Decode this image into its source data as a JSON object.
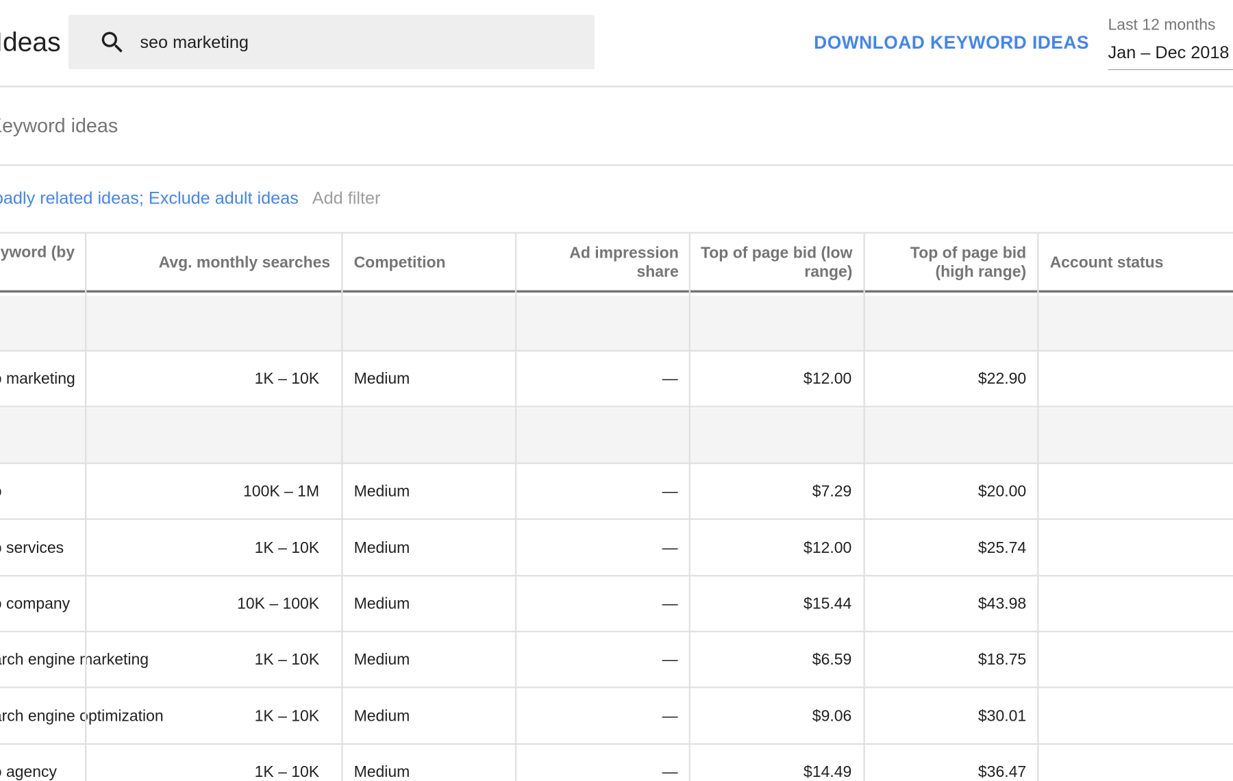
{
  "header": {
    "title": "Ideas",
    "search": {
      "value": "seo marketing"
    },
    "download_label": "DOWNLOAD KEYWORD IDEAS",
    "date_range": {
      "label": "Last 12 months",
      "value": "Jan – Dec 2018"
    }
  },
  "section": {
    "title": "Keyword ideas",
    "filter_text": "Broadly related ideas; Exclude adult ideas",
    "add_filter": "Add filter"
  },
  "table": {
    "columns": {
      "keyword": "Keyword (by",
      "avg": "Avg. monthly searches",
      "competition": "Competition",
      "impression": "Ad impression share",
      "bid_low": "Top of page bid (low range)",
      "bid_high": "Top of page bid (high range)",
      "status": "Account status"
    },
    "rows": [
      {
        "type": "group"
      },
      {
        "type": "data",
        "keyword": "seo marketing",
        "avg": "1K – 10K",
        "competition": "Medium",
        "impression": "—",
        "bid_low": "$12.00",
        "bid_high": "$22.90",
        "status": ""
      },
      {
        "type": "group"
      },
      {
        "type": "data",
        "keyword": "seo",
        "avg": "100K – 1M",
        "competition": "Medium",
        "impression": "—",
        "bid_low": "$7.29",
        "bid_high": "$20.00",
        "status": ""
      },
      {
        "type": "data",
        "keyword": "seo services",
        "avg": "1K – 10K",
        "competition": "Medium",
        "impression": "—",
        "bid_low": "$12.00",
        "bid_high": "$25.74",
        "status": ""
      },
      {
        "type": "data",
        "keyword": "seo company",
        "avg": "10K – 100K",
        "competition": "Medium",
        "impression": "—",
        "bid_low": "$15.44",
        "bid_high": "$43.98",
        "status": ""
      },
      {
        "type": "data",
        "keyword": "search engine marketing",
        "avg": "1K – 10K",
        "competition": "Medium",
        "impression": "—",
        "bid_low": "$6.59",
        "bid_high": "$18.75",
        "status": ""
      },
      {
        "type": "data",
        "keyword": "search engine optimization",
        "avg": "1K – 10K",
        "competition": "Medium",
        "impression": "—",
        "bid_low": "$9.06",
        "bid_high": "$30.01",
        "status": ""
      },
      {
        "type": "data",
        "keyword": "seo agency",
        "avg": "1K – 10K",
        "competition": "Medium",
        "impression": "—",
        "bid_low": "$14.49",
        "bid_high": "$36.47",
        "status": ""
      }
    ]
  },
  "colors": {
    "accent": "#4285f4",
    "header_divider": "#757575",
    "group_row_bg": "#f4f4f4"
  }
}
